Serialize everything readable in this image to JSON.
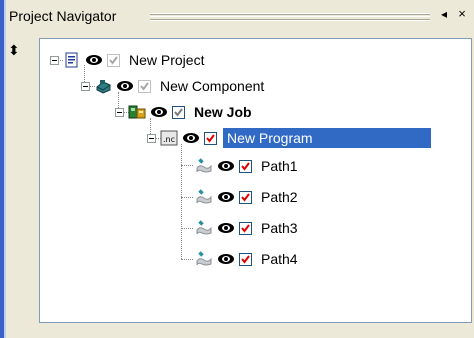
{
  "panel": {
    "title": "Project Navigator",
    "collapse_glyph": "◂",
    "close_glyph": "×",
    "sort_glyph": "⬍"
  },
  "tree": [
    {
      "label": "New Project",
      "icon": "project-document-icon",
      "visible": true,
      "checked": true,
      "check_style": "gray"
    },
    {
      "label": "New Component",
      "icon": "component-icon",
      "visible": true,
      "checked": true,
      "check_style": "gray"
    },
    {
      "label": "New Job",
      "icon": "job-machine-icon",
      "visible": true,
      "checked": true,
      "check_style": "gray",
      "bold": true
    },
    {
      "label": "New Program",
      "icon": "nc-program-icon",
      "visible": true,
      "checked": true,
      "check_style": "red",
      "selected": true
    },
    {
      "label": "Path1",
      "icon": "toolpath-icon",
      "visible": true,
      "checked": true,
      "check_style": "red"
    },
    {
      "label": "Path2",
      "icon": "toolpath-icon",
      "visible": true,
      "checked": true,
      "check_style": "red"
    },
    {
      "label": "Path3",
      "icon": "toolpath-icon",
      "visible": true,
      "checked": true,
      "check_style": "red"
    },
    {
      "label": "Path4",
      "icon": "toolpath-icon",
      "visible": true,
      "checked": true,
      "check_style": "red"
    }
  ],
  "colors": {
    "selection": "#316ac5",
    "frame_accent": "#3b63c7",
    "panel_bg": "#ece9d8",
    "check_red": "#e00000",
    "check_gray": "#a8a8a8"
  }
}
